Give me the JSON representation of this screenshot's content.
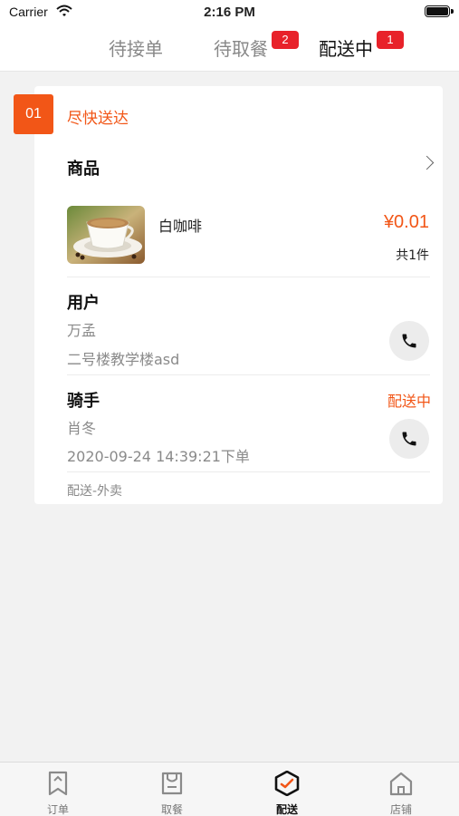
{
  "status_bar": {
    "carrier": "Carrier",
    "time": "2:16 PM"
  },
  "tabs": [
    {
      "label": "待接单",
      "badge": ""
    },
    {
      "label": "待取餐",
      "badge": "2"
    },
    {
      "label": "配送中",
      "badge": "1",
      "active": true
    }
  ],
  "order": {
    "number": "01",
    "urgency": "尽快送达",
    "goods_title": "商品",
    "item": {
      "name": "白咖啡",
      "price": "¥0.01",
      "quantity": "共1件",
      "image": "coffee-cup-photo"
    },
    "customer": {
      "title": "用户",
      "name": "万孟",
      "address": "二号楼教学楼asd"
    },
    "rider": {
      "title": "骑手",
      "status": "配送中",
      "name": "肖冬",
      "time": "2020-09-24 14:39:21下单"
    },
    "footer": "配送-外卖"
  },
  "bottom_nav": [
    {
      "label": "订单",
      "icon": "bookmark-icon"
    },
    {
      "label": "取餐",
      "icon": "bag-icon"
    },
    {
      "label": "配送",
      "icon": "delivery-icon",
      "active": true
    },
    {
      "label": "店铺",
      "icon": "store-icon"
    }
  ],
  "colors": {
    "accent": "#f25617",
    "badge": "#e8222a",
    "background": "#f2f2f2"
  }
}
